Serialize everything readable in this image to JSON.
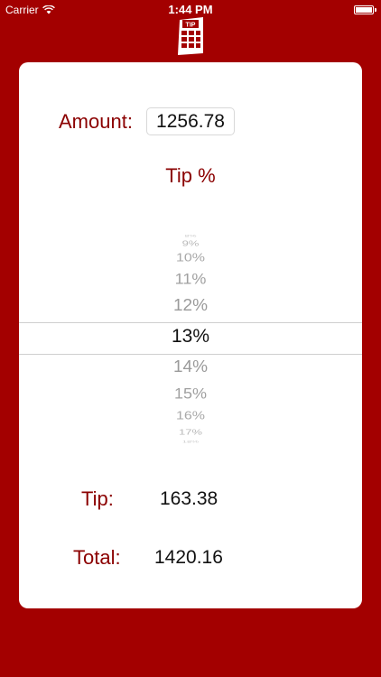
{
  "status_bar": {
    "carrier": "Carrier",
    "time": "1:44 PM"
  },
  "logo": {
    "text": "TIP"
  },
  "amount": {
    "label": "Amount:",
    "value": "1256.78"
  },
  "tip_percent": {
    "label": "Tip %",
    "options": [
      "8%",
      "9%",
      "10%",
      "11%",
      "12%",
      "13%",
      "14%",
      "15%",
      "16%",
      "17%",
      "18%"
    ],
    "selected": "13%"
  },
  "results": {
    "tip_label": "Tip:",
    "tip_value": "163.38",
    "total_label": "Total:",
    "total_value": "1420.16"
  },
  "colors": {
    "background": "#a30000",
    "label": "#8b0000",
    "card": "#ffffff"
  }
}
